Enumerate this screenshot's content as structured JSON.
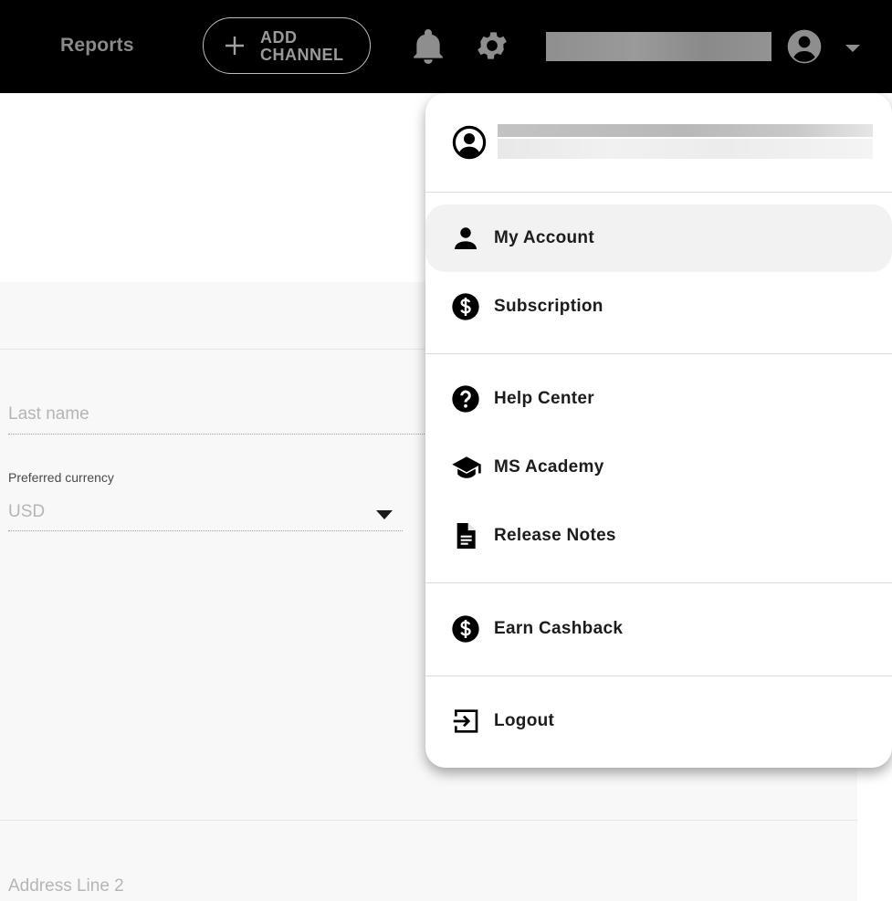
{
  "topbar": {
    "reports_label": "Reports",
    "add_channel_label": "ADD CHANNEL"
  },
  "form": {
    "last_name_placeholder": "Last name",
    "currency_label": "Preferred currency",
    "currency_value": "USD",
    "address2_placeholder": "Address Line 2"
  },
  "menu": {
    "items": [
      {
        "label": "My Account",
        "icon": "person-icon"
      },
      {
        "label": "Subscription",
        "icon": "dollar-circle-icon"
      },
      {
        "label": "Help Center",
        "icon": "help-circle-icon"
      },
      {
        "label": "MS Academy",
        "icon": "graduation-cap-icon"
      },
      {
        "label": "Release Notes",
        "icon": "document-icon"
      },
      {
        "label": "Earn Cashback",
        "icon": "dollar-circle-icon"
      },
      {
        "label": "Logout",
        "icon": "logout-icon"
      }
    ]
  },
  "colors": {
    "topbar_bg": "#000000",
    "menu_active_bg": "#f2f2f2",
    "page_bg": "#f8f8f8"
  }
}
